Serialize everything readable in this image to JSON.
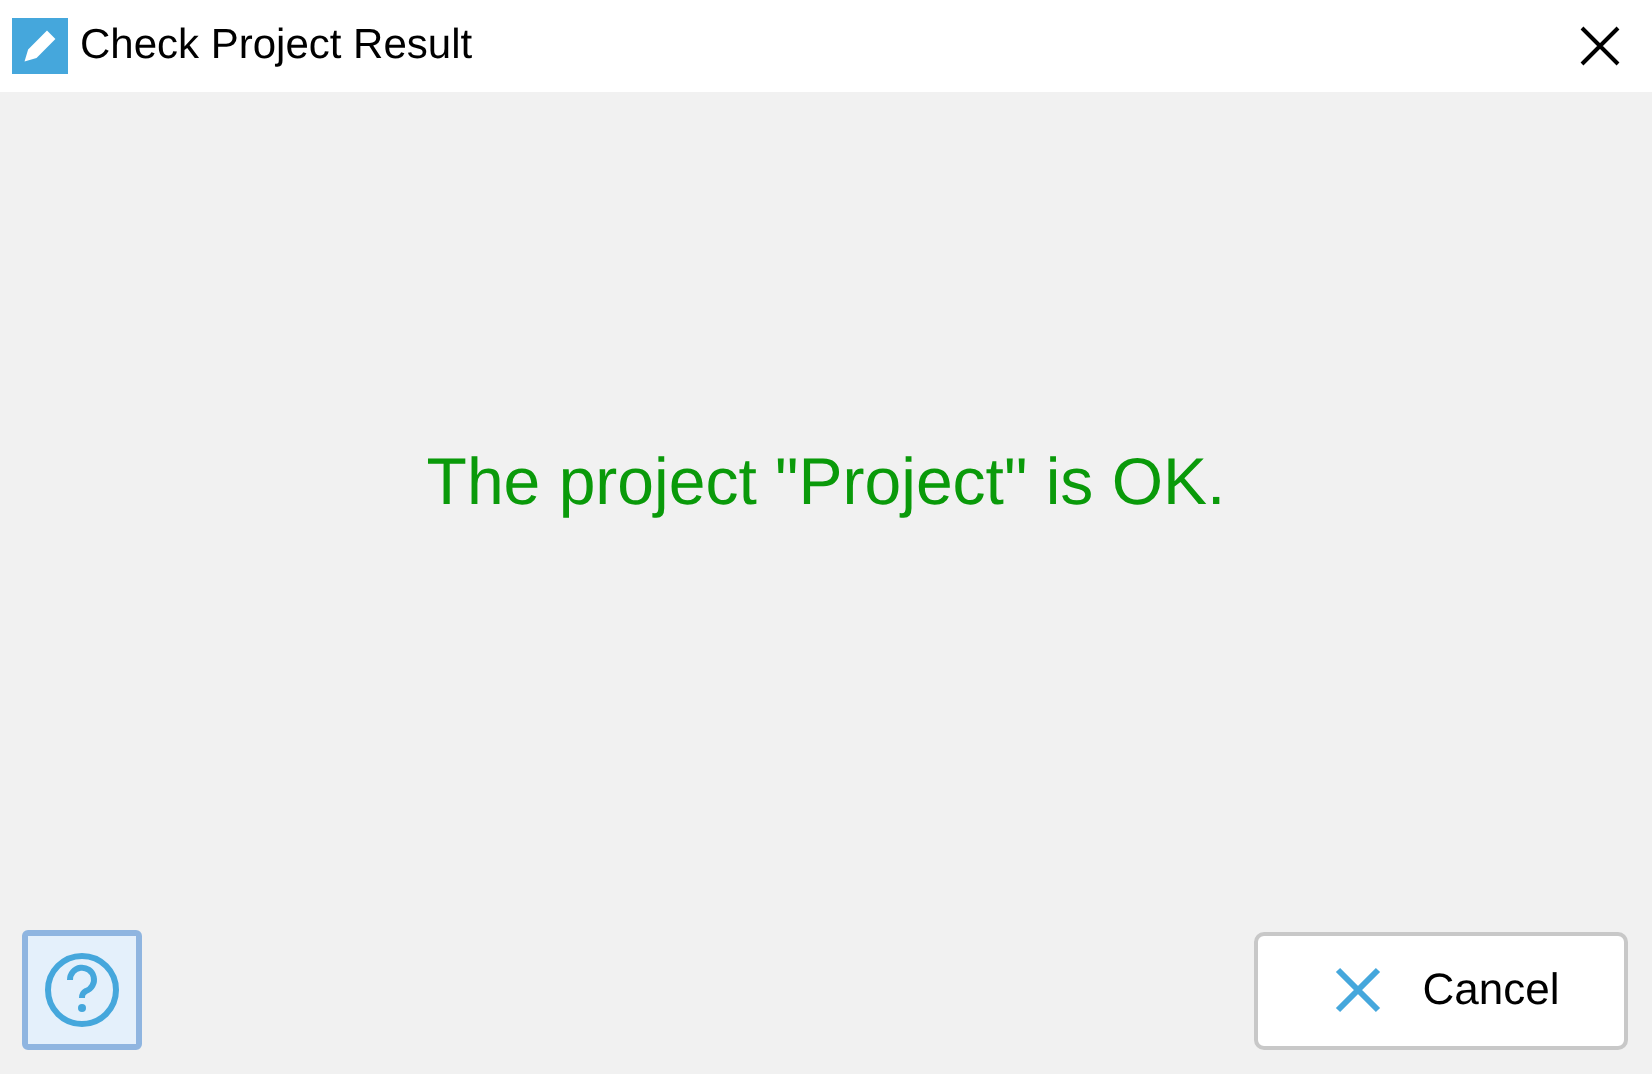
{
  "window": {
    "title": "Check Project Result"
  },
  "message": {
    "text": "The project \"Project\" is OK.",
    "color": "#0a9a0a"
  },
  "buttons": {
    "cancel": "Cancel"
  }
}
